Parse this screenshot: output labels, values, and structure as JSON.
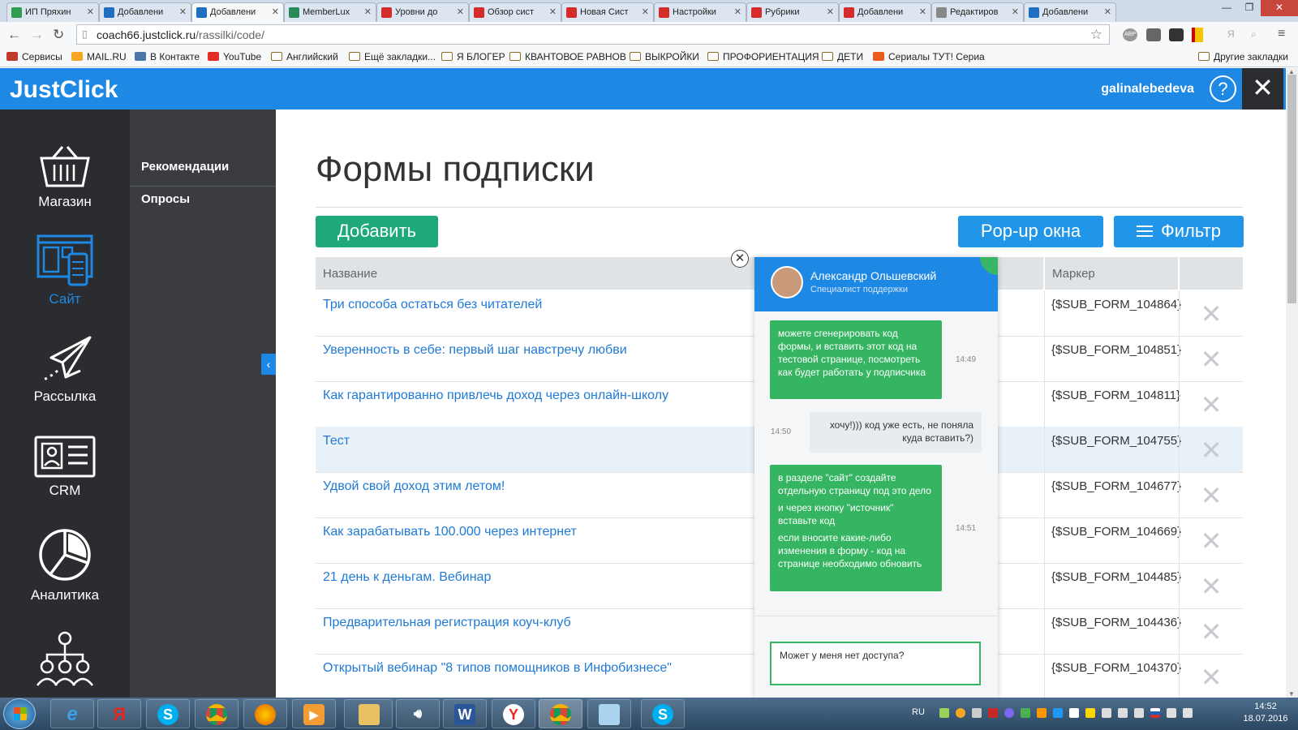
{
  "browser": {
    "tabs": [
      {
        "title": "ИП Пряхин",
        "color": "#2e9d4f"
      },
      {
        "title": "Добавлени",
        "color": "#1e6fbf"
      },
      {
        "title": "Добавлени",
        "color": "#1e6fbf",
        "active": true
      },
      {
        "title": "MemberLux",
        "color": "#2a8a5a"
      },
      {
        "title": "Уровни до",
        "color": "#d62b2b"
      },
      {
        "title": "Обзор сист",
        "color": "#d62b2b"
      },
      {
        "title": "Новая Сист",
        "color": "#d62b2b"
      },
      {
        "title": "Настройки",
        "color": "#d62b2b"
      },
      {
        "title": "Рубрики",
        "color": "#d62b2b"
      },
      {
        "title": "Добавлени",
        "color": "#d62b2b"
      },
      {
        "title": "Редактиров",
        "color": "#888888"
      },
      {
        "title": "Добавлени",
        "color": "#1e6fbf"
      }
    ],
    "url_host": "coach66.justclick.ru",
    "url_path": "/rassilki/code/",
    "bookmarks": [
      {
        "label": "Сервисы",
        "icon": "apps-icon"
      },
      {
        "label": "MAIL.RU",
        "icon": "mailru-icon"
      },
      {
        "label": "В Контакте",
        "icon": "vk-icon"
      },
      {
        "label": "YouTube",
        "icon": "youtube-icon"
      },
      {
        "label": "Английский",
        "icon": "folder-icon"
      },
      {
        "label": "Ещё закладки...",
        "icon": "folder-icon"
      },
      {
        "label": "Я БЛОГЕР",
        "icon": "folder-icon"
      },
      {
        "label": "КВАНТОВОЕ РАВНОВ",
        "icon": "folder-icon"
      },
      {
        "label": "ВЫКРОЙКИ",
        "icon": "folder-icon"
      },
      {
        "label": "ПРОФОРИЕНТАЦИЯ",
        "icon": "folder-icon"
      },
      {
        "label": "ДЕТИ",
        "icon": "folder-icon"
      },
      {
        "label": "Сериалы ТУТ! Сериа",
        "icon": "bookmark-icon"
      }
    ],
    "other_bookmarks": "Другие закладки"
  },
  "app": {
    "logo": "JustClick",
    "user": "galinalebedeva",
    "help": "?",
    "close": "✕",
    "brand_color": "#1e88e5"
  },
  "sidebar": {
    "items": [
      {
        "label": "Магазин",
        "icon": "basket-icon"
      },
      {
        "label": "Сайт",
        "icon": "site-icon",
        "active": true
      },
      {
        "label": "Рассылка",
        "icon": "paper-plane-icon"
      },
      {
        "label": "CRM",
        "icon": "contact-card-icon"
      },
      {
        "label": "Аналитика",
        "icon": "pie-chart-icon"
      },
      {
        "label": "",
        "icon": "team-icon"
      }
    ]
  },
  "subnav": {
    "items": [
      "Рекомендации",
      "Опросы"
    ]
  },
  "main": {
    "title": "Формы подписки",
    "add_button": "Добавить",
    "popup_button": "Pop-up окна",
    "filter_button": "Фильтр",
    "table": {
      "headers": {
        "name": "Название",
        "marker": "Маркер"
      },
      "rows": [
        {
          "name": "Три способа остаться без читателей",
          "marker": "{$SUB_FORM_104864}"
        },
        {
          "name": "Уверенность в себе: первый шаг навстречу любви",
          "marker": "{$SUB_FORM_104851}"
        },
        {
          "name": "Как гарантированно привлечь доход через онлайн-школу",
          "marker": "{$SUB_FORM_104811}"
        },
        {
          "name": "Тест",
          "marker": "{$SUB_FORM_104755}",
          "highlighted": true
        },
        {
          "name": "Удвой свой доход этим летом!",
          "marker": "{$SUB_FORM_104677}"
        },
        {
          "name": "Как зарабатывать 100.000 через интернет",
          "marker": "{$SUB_FORM_104669}"
        },
        {
          "name": "21 день к деньгам. Вебинар",
          "marker": "{$SUB_FORM_104485}"
        },
        {
          "name": "Предварительная регистрация коуч-клуб",
          "marker": "{$SUB_FORM_104436}"
        },
        {
          "name": "Открытый вебинар \"8 типов помощников в Инфобизнесе\"",
          "marker": "{$SUB_FORM_104370}"
        }
      ]
    }
  },
  "chat": {
    "agent_name": "Александр Ольшевский",
    "agent_role": "Специалист поддержки",
    "messages": [
      {
        "from": "agent",
        "text": "можете сгенерировать код формы, и вставить этот код на тестовой странице, посмотреть как будет работать у подписчика",
        "time": "14:49"
      },
      {
        "from": "user",
        "text": "хочу!))) код уже есть, не поняла куда вставить?)",
        "time": "14:50"
      },
      {
        "from": "agent",
        "text1": "в разделе \"сайт\" создайте отдельную страницу под это дело",
        "text2": "и через кнопку \"источник\" вставьте код",
        "text3": "если вносите какие-либо изменения в форму - код на странице необходимо обновить",
        "time": "14:51"
      }
    ],
    "input_value": "Может у меня нет доступа?"
  },
  "taskbar": {
    "lang": "RU",
    "time": "14:52",
    "date": "18.07.2016"
  }
}
